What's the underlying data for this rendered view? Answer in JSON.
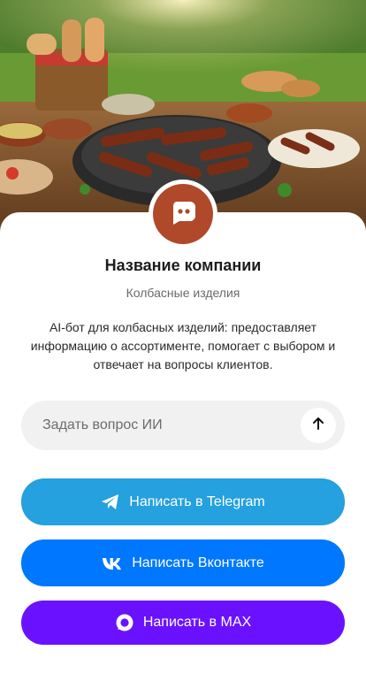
{
  "company": {
    "name": "Название компании",
    "category": "Колбасные изделия",
    "description": "AI-бот для колбасных изделий: предоставляет информацию о ассортименте, помогает с выбором и отвечает на вопросы клиентов."
  },
  "ask": {
    "placeholder": "Задать вопрос ИИ",
    "send_icon": "arrow-up-icon"
  },
  "buttons": {
    "telegram": {
      "label": "Написать в Telegram",
      "icon": "telegram-icon",
      "color": "#24a1de"
    },
    "vk": {
      "label": "Написать Вконтакте",
      "icon": "vk-icon",
      "color": "#0077ff"
    },
    "max": {
      "label": "Написать в MAX",
      "icon": "max-icon",
      "color": "#6a12ff"
    }
  },
  "avatar": {
    "icon": "chat-bot-icon",
    "color": "#b0492a"
  }
}
